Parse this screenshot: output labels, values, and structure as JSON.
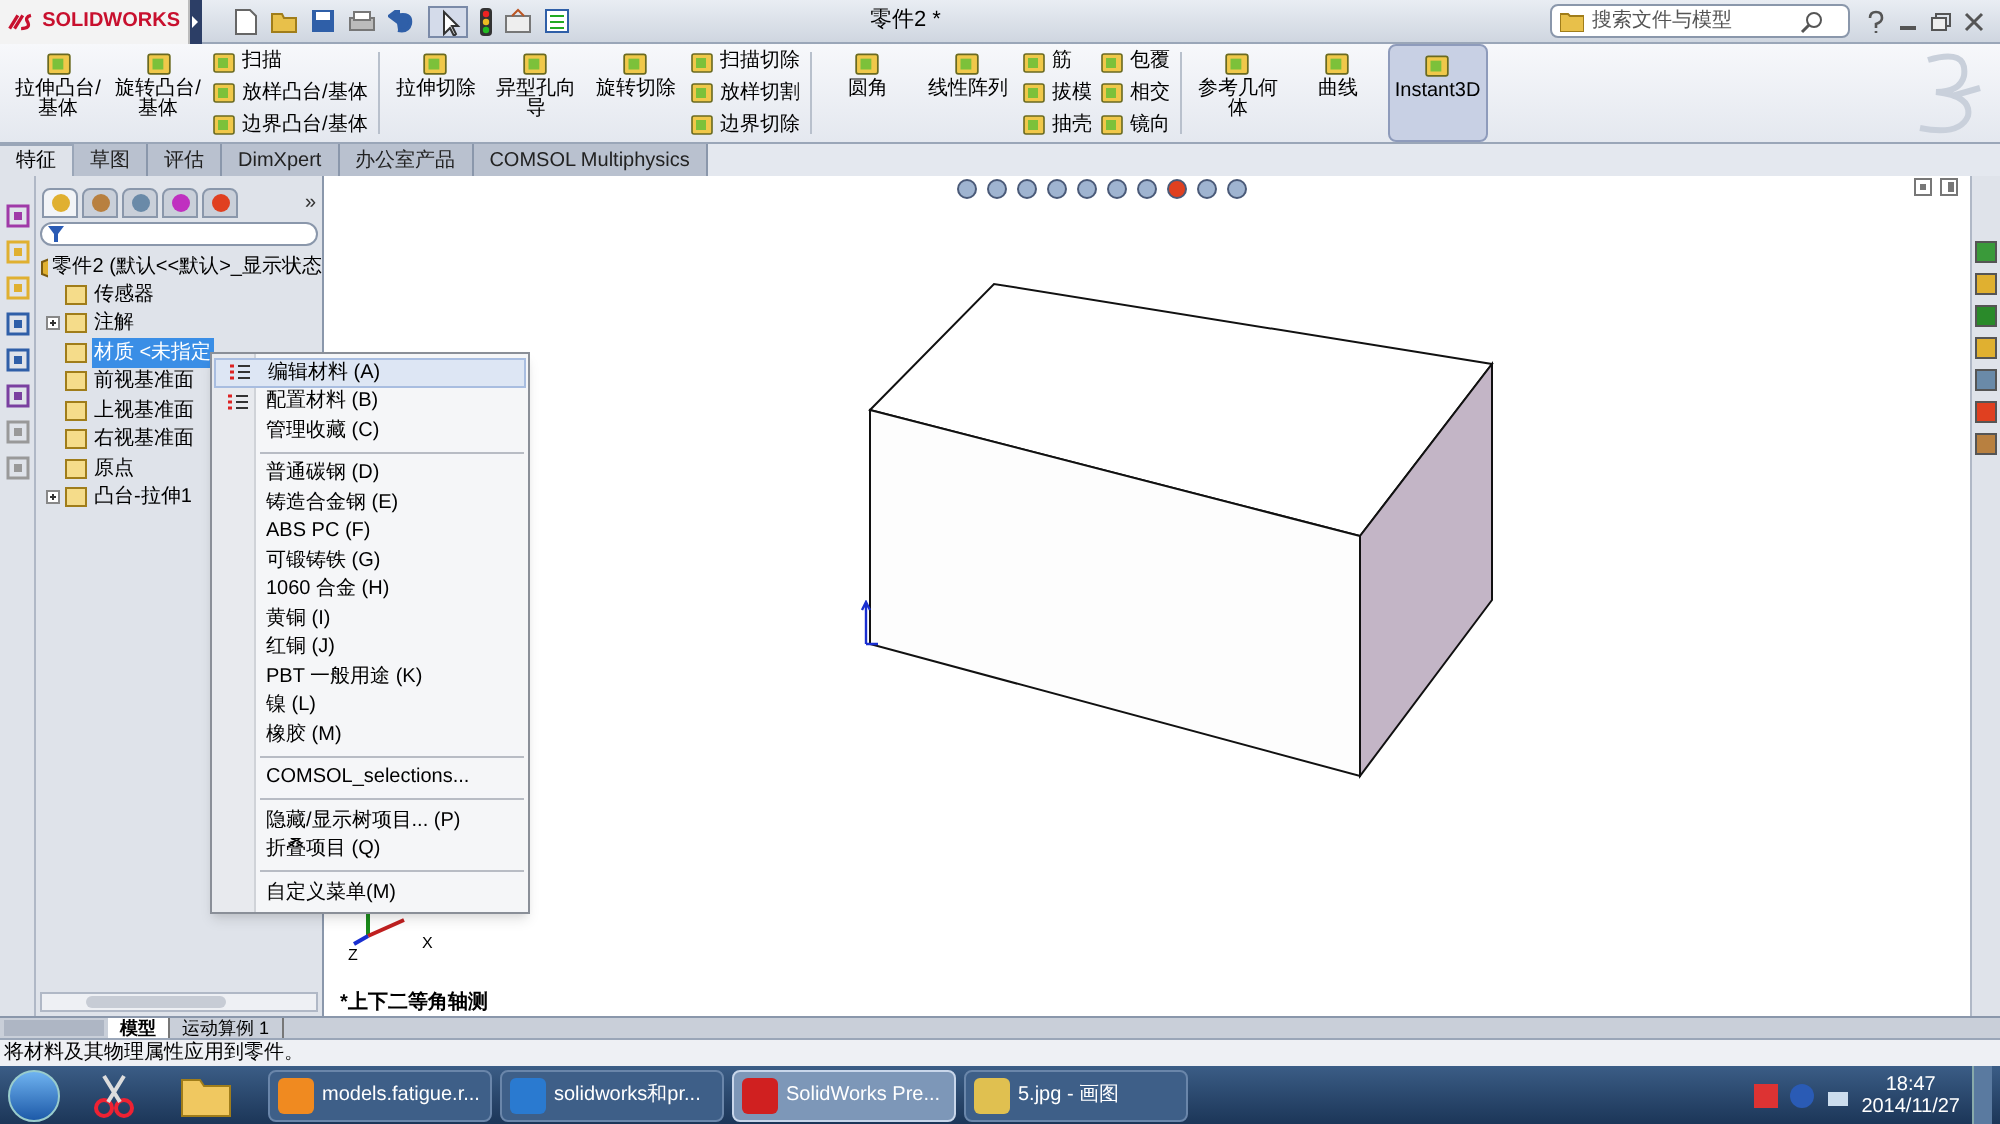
{
  "app": {
    "logo": "SOLIDWORKS",
    "title": "零件2 *",
    "search": {
      "placeholder": "搜索文件与模型"
    }
  },
  "ribbon": [
    {
      "kind": "large",
      "label": "拉伸凸台/基体",
      "on": false
    },
    {
      "kind": "large",
      "label": "旋转凸台/基体",
      "on": false
    },
    {
      "kind": "stack",
      "items": [
        "扫描",
        "放样凸台/基体",
        "边界凸台/基体"
      ]
    },
    {
      "kind": "separator"
    },
    {
      "kind": "large",
      "label": "拉伸切除",
      "on": false
    },
    {
      "kind": "large",
      "label": "异型孔向导",
      "on": false
    },
    {
      "kind": "large",
      "label": "旋转切除",
      "on": false
    },
    {
      "kind": "stack",
      "items": [
        "扫描切除",
        "放样切割",
        "边界切除"
      ]
    },
    {
      "kind": "separator"
    },
    {
      "kind": "large",
      "label": "圆角",
      "on": false
    },
    {
      "kind": "large",
      "label": "线性阵列",
      "on": false
    },
    {
      "kind": "stack",
      "items": [
        "筋",
        "拔模",
        "抽壳"
      ]
    },
    {
      "kind": "stack",
      "items": [
        "包覆",
        "相交",
        "镜向"
      ]
    },
    {
      "kind": "separator"
    },
    {
      "kind": "large",
      "label": "参考几何体",
      "on": false
    },
    {
      "kind": "large",
      "label": "曲线",
      "on": false
    },
    {
      "kind": "large",
      "label": "Instant3D",
      "on": true
    }
  ],
  "tabs": [
    {
      "label": "特征",
      "selected": true
    },
    {
      "label": "草图",
      "selected": false
    },
    {
      "label": "评估",
      "selected": false
    },
    {
      "label": "DimXpert",
      "selected": false
    },
    {
      "label": "办公室产品",
      "selected": false
    },
    {
      "label": "COMSOL Multiphysics",
      "selected": false
    }
  ],
  "panel_tabs": {
    "tabs": [
      {
        "selected": true
      },
      {
        "selected": false
      },
      {
        "selected": false
      },
      {
        "selected": false
      },
      {
        "selected": false
      }
    ],
    "more": "»"
  },
  "tree": {
    "root": "零件2  (默认<<默认>_显示状态",
    "children": [
      {
        "label": "传感器",
        "kind": "leaf",
        "selected": false
      },
      {
        "label": "注解",
        "kind": "group",
        "selected": false
      },
      {
        "label": "材质 <未指定",
        "kind": "leaf",
        "selected": true
      },
      {
        "label": "前视基准面",
        "kind": "leaf",
        "selected": false
      },
      {
        "label": "上视基准面",
        "kind": "leaf",
        "selected": false
      },
      {
        "label": "右视基准面",
        "kind": "leaf",
        "selected": false
      },
      {
        "label": "原点",
        "kind": "leaf",
        "selected": false
      },
      {
        "label": "凸台-拉伸1",
        "kind": "group",
        "selected": false
      }
    ]
  },
  "context_menu": [
    {
      "kind": "icon_item",
      "label": "编辑材料 (A)",
      "selected": true
    },
    {
      "kind": "icon_item",
      "label": "配置材料 (B)",
      "selected": false
    },
    {
      "kind": "item",
      "label": "管理收藏 (C)",
      "selected": false
    },
    {
      "kind": "separator"
    },
    {
      "kind": "item",
      "label": "普通碳钢 (D)",
      "selected": false
    },
    {
      "kind": "item",
      "label": "铸造合金钢 (E)",
      "selected": false
    },
    {
      "kind": "item",
      "label": "ABS PC (F)",
      "selected": false
    },
    {
      "kind": "item",
      "label": "可锻铸铁 (G)",
      "selected": false
    },
    {
      "kind": "item",
      "label": "1060 合金 (H)",
      "selected": false
    },
    {
      "kind": "item",
      "label": "黄铜 (I)",
      "selected": false
    },
    {
      "kind": "item",
      "label": "红铜 (J)",
      "selected": false
    },
    {
      "kind": "item",
      "label": "PBT 一般用途 (K)",
      "selected": false
    },
    {
      "kind": "item",
      "label": "镍 (L)",
      "selected": false
    },
    {
      "kind": "item",
      "label": "橡胶 (M)",
      "selected": false
    },
    {
      "kind": "separator"
    },
    {
      "kind": "item",
      "label": "COMSOL_selections...",
      "selected": false
    },
    {
      "kind": "separator"
    },
    {
      "kind": "item",
      "label": "隐藏/显示树项目... (P)",
      "selected": false
    },
    {
      "kind": "item",
      "label": "折叠项目 (Q)",
      "selected": false
    },
    {
      "kind": "separator"
    },
    {
      "kind": "item",
      "label": "自定义菜单(M)",
      "selected": false
    }
  ],
  "viewport": {
    "view_name": "*上下二等角轴测",
    "axis_labels": [
      "Z",
      "X"
    ]
  },
  "bottom_tabs": [
    {
      "label": "模型",
      "selected": true
    },
    {
      "label": "运动算例 1",
      "selected": false
    }
  ],
  "status_bar": {
    "message": "将材料及其物理属性应用到零件。"
  },
  "taskbar": {
    "tasks": [
      {
        "label": "models.fatigue.r...",
        "selected": false
      },
      {
        "label": "solidworks和pr...",
        "selected": false
      },
      {
        "label": "SolidWorks Pre...",
        "selected": true
      },
      {
        "label": "5.jpg - 画图",
        "selected": false
      }
    ],
    "time": "18:47",
    "date": "2014/11/27"
  }
}
